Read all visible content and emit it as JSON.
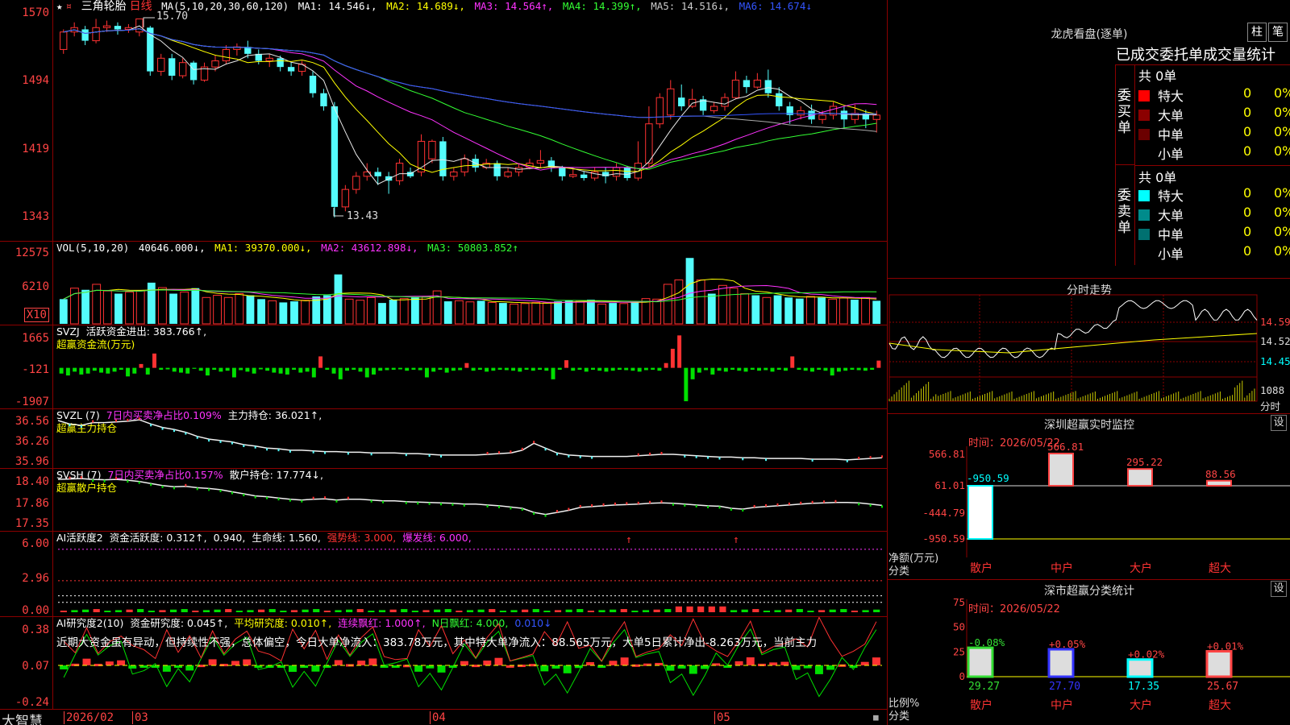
{
  "chart_data": [
    {
      "type": "candlestick",
      "title": "三角轮胎",
      "period": "日线",
      "header": {
        "ma_params": "MA(5,10,20,30,60,120)",
        "ma1": "MA1: 14.546↓,",
        "ma2": "MA2: 14.689↓,",
        "ma3": "MA3: 14.564↑,",
        "ma4": "MA4: 14.399↑,",
        "ma5": "MA5: 14.516↓,",
        "ma6": "MA6: 14.674↓"
      },
      "y_ticks": [
        "1570",
        "1494",
        "1419",
        "1343"
      ],
      "ylim": [
        13.3,
        15.75
      ],
      "annotations": {
        "high": "15.70",
        "low": "13.43"
      },
      "candles": [
        [
          15.35,
          15.55,
          15.58,
          15.3
        ],
        [
          15.55,
          15.6,
          15.66,
          15.5
        ],
        [
          15.58,
          15.45,
          15.62,
          15.4
        ],
        [
          15.45,
          15.6,
          15.7,
          15.42
        ],
        [
          15.6,
          15.62,
          15.68,
          15.55
        ],
        [
          15.62,
          15.58,
          15.66,
          15.52
        ],
        [
          15.58,
          15.6,
          15.64,
          15.54
        ],
        [
          15.55,
          15.7,
          15.7,
          15.5
        ],
        [
          15.6,
          15.1,
          15.62,
          15.05
        ],
        [
          15.1,
          15.25,
          15.3,
          15.05
        ],
        [
          15.25,
          15.05,
          15.3,
          15.0
        ],
        [
          15.05,
          15.2,
          15.25,
          15.02
        ],
        [
          15.2,
          15.0,
          15.22,
          14.95
        ],
        [
          15.0,
          15.15,
          15.2,
          14.98
        ],
        [
          15.15,
          15.22,
          15.28,
          15.1
        ],
        [
          15.22,
          15.35,
          15.4,
          15.18
        ],
        [
          15.35,
          15.38,
          15.42,
          15.28
        ],
        [
          15.38,
          15.3,
          15.45,
          15.25
        ],
        [
          15.3,
          15.22,
          15.35,
          15.18
        ],
        [
          15.22,
          15.25,
          15.3,
          15.15
        ],
        [
          15.25,
          15.15,
          15.28,
          15.1
        ],
        [
          15.15,
          15.1,
          15.2,
          15.05
        ],
        [
          15.1,
          15.18,
          15.22,
          15.05
        ],
        [
          15.05,
          14.85,
          15.1,
          14.8
        ],
        [
          14.85,
          14.7,
          14.9,
          14.65
        ],
        [
          14.7,
          13.55,
          14.75,
          13.43
        ],
        [
          13.55,
          13.75,
          13.8,
          13.5
        ],
        [
          13.75,
          13.9,
          13.95,
          13.7
        ],
        [
          13.9,
          13.95,
          14.05,
          13.85
        ],
        [
          13.95,
          13.9,
          14.0,
          13.8
        ],
        [
          13.9,
          13.85,
          13.95,
          13.7
        ],
        [
          13.85,
          14.05,
          14.1,
          13.8
        ],
        [
          13.95,
          13.9,
          14.0,
          13.88
        ],
        [
          13.95,
          14.3,
          14.38,
          13.9
        ],
        [
          14.1,
          14.3,
          14.32,
          14.05
        ],
        [
          14.3,
          13.9,
          14.35,
          13.85
        ],
        [
          13.9,
          13.95,
          14.0,
          13.85
        ],
        [
          13.95,
          14.1,
          14.15,
          13.9
        ],
        [
          14.1,
          14.0,
          14.15,
          13.95
        ],
        [
          14.0,
          14.05,
          14.1,
          13.98
        ],
        [
          14.05,
          13.9,
          14.08,
          13.85
        ],
        [
          13.9,
          13.95,
          14.0,
          13.88
        ],
        [
          13.95,
          14.0,
          14.05,
          13.9
        ],
        [
          14.0,
          14.05,
          14.1,
          13.98
        ],
        [
          14.05,
          14.08,
          14.2,
          14.0
        ],
        [
          14.08,
          14.0,
          14.12,
          13.95
        ],
        [
          14.0,
          13.9,
          14.02,
          13.85
        ],
        [
          13.9,
          13.92,
          13.98,
          13.88
        ],
        [
          13.92,
          13.88,
          13.96,
          13.85
        ],
        [
          13.88,
          13.95,
          14.0,
          13.85
        ],
        [
          13.95,
          13.9,
          14.0,
          13.82
        ],
        [
          13.9,
          14.0,
          14.05,
          13.85
        ],
        [
          14.0,
          13.88,
          14.02,
          13.85
        ],
        [
          13.88,
          14.05,
          14.3,
          13.85
        ],
        [
          14.05,
          14.5,
          14.7,
          14.0
        ],
        [
          14.5,
          14.8,
          14.85,
          14.45
        ],
        [
          14.6,
          14.9,
          15.0,
          14.55
        ],
        [
          14.8,
          14.7,
          14.95,
          14.65
        ],
        [
          14.7,
          14.78,
          14.9,
          14.68
        ],
        [
          14.78,
          14.65,
          14.82,
          14.6
        ],
        [
          14.65,
          14.7,
          14.75,
          14.62
        ],
        [
          14.7,
          14.8,
          14.85,
          14.65
        ],
        [
          14.8,
          15.0,
          15.1,
          14.78
        ],
        [
          15.0,
          14.92,
          15.05,
          14.85
        ],
        [
          14.92,
          15.0,
          15.08,
          14.9
        ],
        [
          15.0,
          14.85,
          15.12,
          14.8
        ],
        [
          14.85,
          14.7,
          14.92,
          14.65
        ],
        [
          14.7,
          14.6,
          14.75,
          14.5
        ],
        [
          14.6,
          14.65,
          14.7,
          14.55
        ],
        [
          14.65,
          14.55,
          14.72,
          14.5
        ],
        [
          14.55,
          14.6,
          14.65,
          14.5
        ],
        [
          14.6,
          14.7,
          14.75,
          14.55
        ],
        [
          14.65,
          14.55,
          14.7,
          14.45
        ],
        [
          14.55,
          14.62,
          14.72,
          14.5
        ],
        [
          14.62,
          14.55,
          14.66,
          14.45
        ],
        [
          14.55,
          14.6,
          14.65,
          14.4
        ]
      ]
    },
    {
      "type": "bar",
      "title": "VOL(5,10,20)",
      "header": {
        "value": "40646.000↓,",
        "ma1": "MA1: 39370.000↓,",
        "ma2": "MA2: 43612.898↓,",
        "ma3": "MA3: 50803.852↑"
      },
      "y_ticks": [
        "12575",
        "6210",
        "X10"
      ],
      "ylim": [
        0,
        13500
      ],
      "values": [
        4500,
        6500,
        6200,
        7200,
        6000,
        5500,
        5800,
        6000,
        7500,
        6600,
        5500,
        5800,
        6500,
        4800,
        5200,
        4800,
        5500,
        5200,
        4500,
        4200,
        3900,
        4100,
        4300,
        5000,
        5200,
        9000,
        4500,
        4300,
        4800,
        3800,
        4400,
        4600,
        4800,
        5000,
        6000,
        4100,
        4200,
        4000,
        4200,
        3900,
        3800,
        3600,
        3700,
        3900,
        3800,
        4100,
        4300,
        4200,
        4400,
        3600,
        3800,
        3700,
        4000,
        4600,
        4500,
        7200,
        8000,
        12000,
        8000,
        5500,
        7000,
        6500,
        5500,
        5200,
        4800,
        5200,
        4800,
        4600,
        5000,
        4800,
        4500,
        4700,
        4400,
        4800,
        4200
      ],
      "up": [
        0,
        1,
        0,
        1,
        1,
        0,
        1,
        1,
        0,
        1,
        0,
        1,
        0,
        1,
        1,
        1,
        1,
        0,
        0,
        1,
        0,
        0,
        1,
        0,
        0,
        0,
        1,
        1,
        1,
        0,
        0,
        1,
        0,
        1,
        1,
        0,
        1,
        1,
        0,
        1,
        0,
        1,
        1,
        1,
        1,
        0,
        0,
        1,
        0,
        1,
        0,
        1,
        0,
        1,
        1,
        1,
        1,
        0,
        1,
        0,
        1,
        1,
        1,
        0,
        1,
        0,
        0,
        0,
        1,
        0,
        1,
        1,
        0,
        1,
        0
      ]
    },
    {
      "type": "bar",
      "title": "SVZJ",
      "header": {
        "label": "活跃资金进出: 383.766↑,",
        "sub": "超赢资金流(万元)"
      },
      "y_ticks": [
        "1665",
        "-121",
        "-1907"
      ],
      "ylim": [
        -2000,
        1800
      ],
      "values": [
        -300,
        -400,
        -200,
        -350,
        -300,
        -150,
        -250,
        -300,
        -200,
        -100,
        -450,
        -300,
        200,
        -350,
        750,
        -100,
        -80,
        -200,
        -250,
        -300,
        -50,
        -150,
        -400,
        -100,
        -200,
        -150,
        -500,
        -120,
        -200,
        -300,
        -80,
        -150,
        -250,
        -300,
        -350,
        -100,
        -250,
        -200,
        -500,
        600,
        -100,
        -300,
        -600,
        -150,
        -100,
        -200,
        -500,
        -350,
        -150,
        -120,
        -100,
        -80,
        -150,
        -100,
        -120,
        -500,
        -200,
        -100,
        -250,
        -150,
        -120,
        250,
        -150,
        -100,
        -200,
        -150,
        -100,
        -120,
        -150,
        -200,
        -100,
        -150,
        -100,
        -150,
        -600,
        -100,
        400,
        -150,
        -100,
        -200,
        -100,
        -150,
        -200,
        -150,
        -100,
        -120,
        -150,
        -200,
        -120,
        -100,
        -150,
        250,
        1000,
        1700,
        -1750,
        -600,
        -250,
        -120,
        -350,
        -150,
        -200,
        -100,
        -150,
        -200,
        -100,
        -150,
        -120,
        -200,
        -100,
        -150,
        600,
        -100,
        -150,
        -200,
        -100,
        -150,
        -400,
        -200,
        -150,
        -100,
        -120,
        -150,
        -100,
        380
      ]
    },
    {
      "type": "line",
      "title": "SVZL (7)",
      "header": {
        "a": "7日内买卖净占比0.109%",
        "b": "主力持仓: 36.021↑,",
        "sub": "超赢主力持仓"
      },
      "y_ticks": [
        "36.56",
        "36.26",
        "35.96"
      ],
      "ylim": [
        35.92,
        36.62
      ],
      "values": [
        36.55,
        36.5,
        36.48,
        36.52,
        36.52,
        36.53,
        36.54,
        36.56,
        36.5,
        36.45,
        36.42,
        36.38,
        36.32,
        36.28,
        36.26,
        36.24,
        36.2,
        36.18,
        36.15,
        36.14,
        36.12,
        36.12,
        36.11,
        36.1,
        36.1,
        36.09,
        36.09,
        36.08,
        36.08,
        36.08,
        36.07,
        36.07,
        36.06,
        36.05,
        36.05,
        36.05,
        36.05,
        36.06,
        36.07,
        36.08,
        36.12,
        36.22,
        36.15,
        36.08,
        36.05,
        36.04,
        36.03,
        36.03,
        36.03,
        36.03,
        36.04,
        36.05,
        36.06,
        36.06,
        36.05,
        36.04,
        36.03,
        36.02,
        36.02,
        36.01,
        36.01,
        36.0,
        36.0,
        36.0,
        36.0,
        35.99,
        35.99,
        35.99,
        35.98,
        35.99,
        36.0,
        36.01
      ]
    },
    {
      "type": "line",
      "title": "SVSH (7)",
      "header": {
        "a": "7日内买卖净占比0.157%",
        "b": "散户持仓: 17.774↓,",
        "sub": "超赢散户持仓"
      },
      "y_ticks": [
        "18.40",
        "17.86",
        "17.35"
      ],
      "ylim": [
        17.25,
        18.5
      ],
      "values": [
        18.4,
        18.41,
        18.42,
        18.4,
        18.39,
        18.4,
        18.38,
        18.35,
        18.3,
        18.25,
        18.22,
        18.23,
        18.2,
        18.18,
        18.15,
        18.1,
        18.05,
        18.0,
        17.98,
        17.95,
        17.92,
        17.9,
        17.92,
        17.93,
        17.9,
        17.92,
        17.92,
        17.9,
        17.88,
        17.88,
        17.86,
        17.85,
        17.84,
        17.83,
        17.82,
        17.8,
        17.8,
        17.78,
        17.76,
        17.73,
        17.7,
        17.6,
        17.55,
        17.6,
        17.65,
        17.72,
        17.74,
        17.76,
        17.78,
        17.79,
        17.8,
        17.82,
        17.83,
        17.82,
        17.8,
        17.78,
        17.76,
        17.75,
        17.7,
        17.68,
        17.72,
        17.74,
        17.76,
        17.78,
        17.8,
        17.82,
        17.83,
        17.84,
        17.84,
        17.83,
        17.8,
        17.77
      ]
    },
    {
      "type": "bar",
      "title": "AI活跃度2",
      "header": {
        "a": "资金活跃度: 0.312↑,",
        "b": "0.940,",
        "c": "生命线: 1.560,",
        "d": "强势线: 3.000,",
        "e": "爆发线: 6.000,"
      },
      "y_ticks": [
        "6.00",
        "2.96",
        "0.00"
      ],
      "ylim": [
        0,
        6.6
      ]
    },
    {
      "type": "bar",
      "title": "AI研究度2(10)",
      "header": {
        "a": "资金研究度: 0.045↑,",
        "b": "平均研究度: 0.010↑,",
        "c": "连续飘红: 1.000↑,",
        "d": "N日飘红: 4.000,",
        "e": "0.010↓"
      },
      "y_ticks": [
        "0.38",
        "0.07",
        "-0.24"
      ],
      "ylim": [
        -0.26,
        0.42
      ],
      "commentary": "近期大资金虽有异动，但持续性不强，总体偏空，今日大单净流入：383.78万元，其中特大单净流入：88.565万元，大单5日累计净出-8.263万元，当前主力"
    }
  ],
  "bottom_bar": {
    "brand": "大智慧",
    "dates": [
      "2026/02",
      "03",
      "04",
      "05"
    ]
  },
  "right_panel": {
    "dragon_title": "龙虎看盘(逐单)",
    "btn_bar": "柱",
    "btn_pen": "笔",
    "stats_title": "已成交委托单成交量统计",
    "buy_total": "共 0单",
    "buy_label": "委买单",
    "sell_total": "共 0单",
    "sell_label": "委卖单",
    "buy_rows": [
      {
        "name": "特大",
        "count": "0",
        "pct": "0%",
        "color": "#ff0000"
      },
      {
        "name": "大单",
        "count": "0",
        "pct": "0%",
        "color": "#8b0000"
      },
      {
        "name": "中单",
        "count": "0",
        "pct": "0%",
        "color": "#6b0000"
      },
      {
        "name": "小单",
        "count": "0",
        "pct": "0%",
        "color": "#000000"
      }
    ],
    "sell_rows": [
      {
        "name": "特大",
        "count": "0",
        "pct": "0%",
        "color": "#00ffff"
      },
      {
        "name": "大单",
        "count": "0",
        "pct": "0%",
        "color": "#008b8b"
      },
      {
        "name": "中单",
        "count": "0",
        "pct": "0%",
        "color": "#007070"
      },
      {
        "name": "小单",
        "count": "0",
        "pct": "0%",
        "color": "#000000"
      }
    ],
    "intraday_title": "分时走势",
    "intraday_prices": [
      "14.59",
      "14.52",
      "14.45"
    ],
    "intraday_vol": "1088",
    "intraday_unit": "分时",
    "monitor_title": "深圳超赢实时监控",
    "monitor_time": "时间：2026/05/22",
    "monitor_yaxis": [
      "566.81",
      "61.01",
      "-444.79",
      "-950.59"
    ],
    "monitor_labels": [
      "-950.59",
      "566.81",
      "295.22",
      "88.56"
    ],
    "monitor_values": [
      -950.59,
      566.81,
      295.22,
      88.56
    ],
    "monitor_axis_title": "净额(万元)",
    "monitor_axis_sub": "分类",
    "categories": [
      "散户",
      "中户",
      "大户",
      "超大"
    ],
    "class_title": "深市超赢分类统计",
    "class_time": "时间：2026/05/22",
    "class_yaxis": [
      "75",
      "50",
      "25",
      "0"
    ],
    "class_changes": [
      "-0.08%",
      "+0.05%",
      "+0.02%",
      "+0.01%"
    ],
    "class_values": [
      29.27,
      27.7,
      17.35,
      25.67
    ],
    "class_value_labels": [
      "29.27",
      "27.70",
      "17.35",
      "25.67"
    ],
    "class_axis_title": "比例%",
    "class_axis_sub": "分类",
    "settings": "设"
  }
}
